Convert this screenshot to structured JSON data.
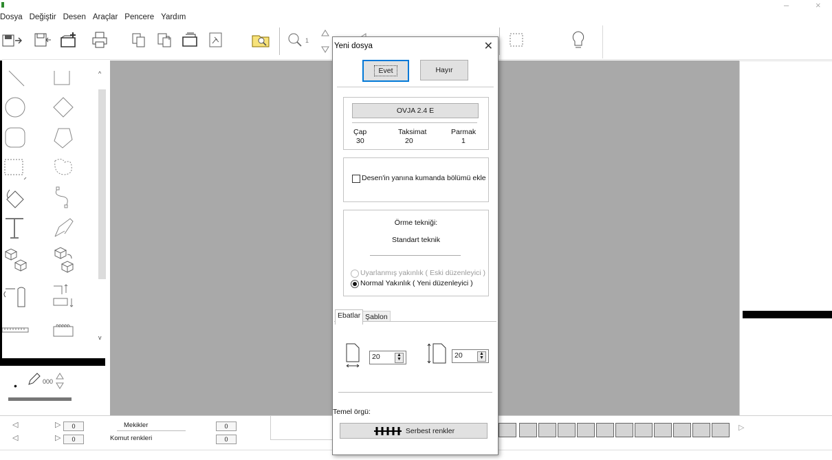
{
  "menu": [
    "Dosya",
    "Değiştir",
    "Desen",
    "Araçlar",
    "Pencere",
    "Yardım"
  ],
  "toolbar": {
    "zoom_level": "1",
    "icons": [
      "new-file-icon",
      "import-icon",
      "open-folder-icon",
      "print-icon",
      "copy-icon",
      "paste-icon",
      "folder-open-icon",
      "bitmap-icon",
      "magnifier-folder-icon",
      "zoom-icon",
      "grid-icon",
      "selection-icon",
      "bulb-icon"
    ]
  },
  "tool_panel": {
    "pen_count": "000"
  },
  "bottom": {
    "shuttles_label": "Mekikler",
    "command_colors_label": "Komut renkleri",
    "value_1": "0",
    "value_2": "0",
    "value_3": "0",
    "value_4": "0"
  },
  "dialog": {
    "title": "Yeni dosya",
    "yes_label": "Evet",
    "no_label": "Hayır",
    "machine_name": "OVJA 2.4 E",
    "diameter_label": "Çap",
    "diameter_value": "30",
    "gauge_label": "Taksimat",
    "gauge_value": "20",
    "finger_label": "Parmak",
    "finger_value": "1",
    "add_command_section_label": "Desen'in yanına kumanda bölümü ekle",
    "add_command_section_checked": false,
    "technique_heading": "Örme tekniği:",
    "technique_value": "Standart teknik",
    "radio_adapted": "Uyarlanmış yakınlık ( Eski düzenleyici )",
    "radio_normal": "Normal Yakınlık ( Yeni düzenleyici )",
    "tabs": [
      "Ebatlar",
      "Şablon"
    ],
    "width_value": "20",
    "height_value": "20",
    "base_knit_label": "Temel örgü:",
    "base_knit_button": "Serbest renkler"
  },
  "colors": {
    "canvas": "#a9a9a9",
    "accent": "#0078d7"
  }
}
